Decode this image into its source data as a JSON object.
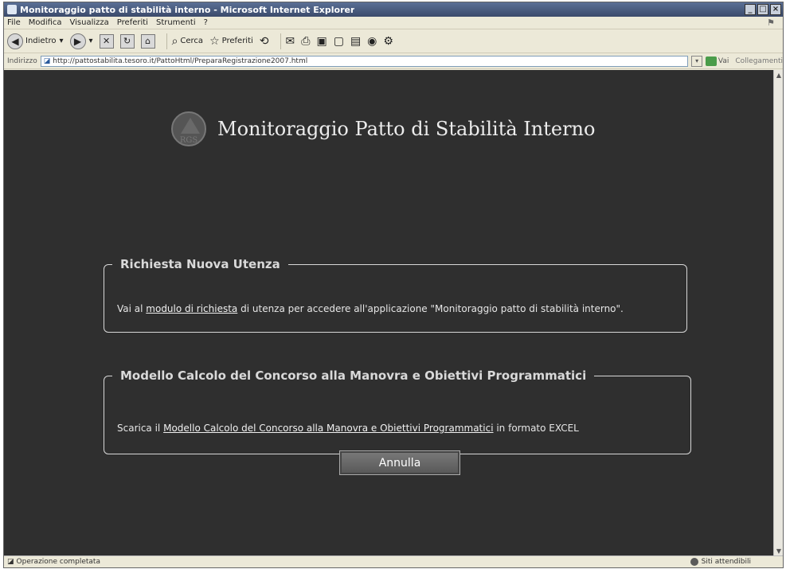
{
  "window": {
    "title": "Monitoraggio patto di stabilità interno - Microsoft Internet Explorer"
  },
  "menu": {
    "items": [
      "File",
      "Modifica",
      "Visualizza",
      "Preferiti",
      "Strumenti",
      "?"
    ]
  },
  "toolbar": {
    "back_label": "Indietro",
    "search_label": "Cerca",
    "favorites_label": "Preferiti"
  },
  "address": {
    "label": "Indirizzo",
    "url": "http://pattostabilita.tesoro.it/PattoHtml/PreparaRegistrazione2007.html",
    "go_label": "Vai",
    "links_label": "Collegamenti"
  },
  "page": {
    "title": "Monitoraggio Patto di Stabilità Interno",
    "logo_text": "RGS",
    "section1": {
      "legend": "Richiesta Nuova Utenza",
      "text_before": "Vai al ",
      "link": "modulo di richiesta",
      "text_after": " di utenza per accedere all'applicazione \"Monitoraggio patto di stabilità interno\"."
    },
    "section2": {
      "legend": "Modello Calcolo del Concorso alla Manovra e Obiettivi Programmatici",
      "text_before": "Scarica il ",
      "link": "Modello Calcolo del Concorso alla Manovra e Obiettivi Programmatici",
      "text_after": " in formato EXCEL"
    },
    "cancel_button": "Annulla"
  },
  "status": {
    "left": "Operazione completata",
    "right": "Siti attendibili"
  }
}
